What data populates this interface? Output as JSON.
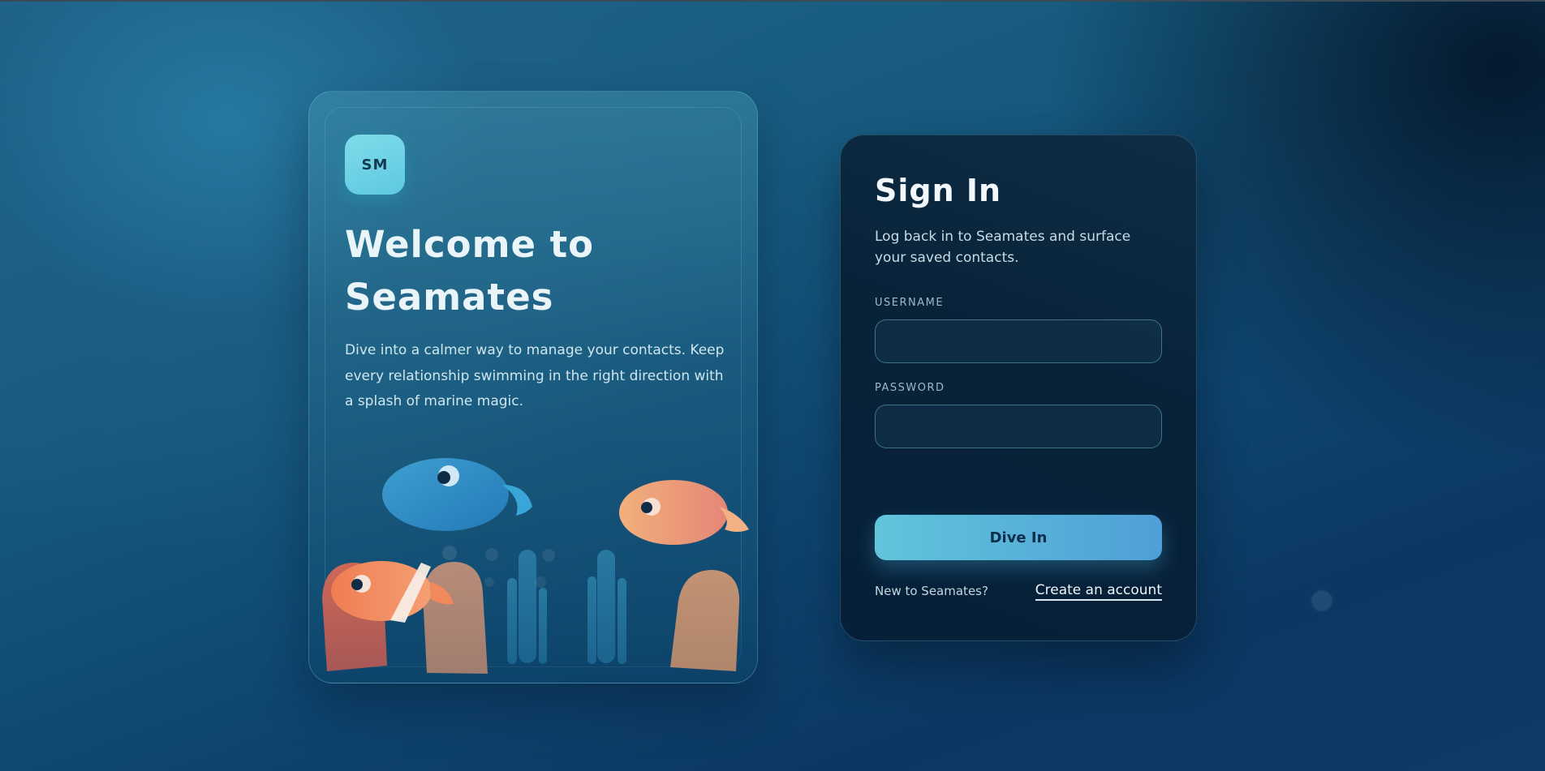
{
  "welcome": {
    "logo_text": "SM",
    "title": "Welcome to Seamates",
    "description": "Dive into a calmer way to manage your contacts. Keep every relationship swimming in the right direction with a splash of marine magic."
  },
  "signin": {
    "title": "Sign In",
    "subtitle": "Log back in to Seamates and surface your saved contacts.",
    "username_label": "USERNAME",
    "username_value": "",
    "password_label": "PASSWORD",
    "password_value": "",
    "submit_label": "Dive In",
    "signup_prompt": "New to Seamates?",
    "signup_link": "Create an account"
  },
  "icons": {
    "logo": "seamates-logo-badge",
    "illustration": "aquarium-fish-illustration"
  },
  "colors": {
    "accent": "#62c5da",
    "button_gradient_end": "#4f9fd8",
    "logo_bg": "#74d3e4",
    "card_dark": "#082238",
    "fish_blue": "#2f8ec4",
    "fish_orange": "#f08a5d",
    "fish_peach": "#eea982"
  }
}
